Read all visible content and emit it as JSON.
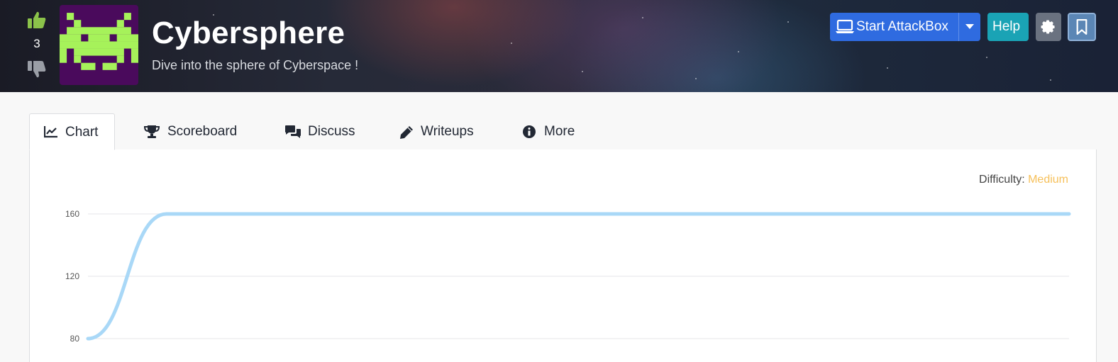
{
  "room": {
    "title": "Cybersphere",
    "subtitle": "Dive into the sphere of Cyberspace !",
    "votes": "3",
    "logo_colors": {
      "background": "#4a0a5c",
      "invader": "#a6f25a"
    }
  },
  "header_buttons": {
    "attackbox_label": "Start AttackBox",
    "help_label": "Help",
    "icons": [
      "thumbs-up-icon",
      "thumbs-down-icon",
      "laptop-icon",
      "caret-down-icon",
      "gear-icon",
      "bookmark-icon"
    ]
  },
  "tabs": [
    {
      "label": "Chart",
      "icon": "chart-line-icon",
      "active": true
    },
    {
      "label": "Scoreboard",
      "icon": "trophy-icon"
    },
    {
      "label": "Discuss",
      "icon": "comments-icon"
    },
    {
      "label": "Writeups",
      "icon": "pen-icon"
    },
    {
      "label": "More",
      "icon": "info-circle-icon"
    }
  ],
  "difficulty": {
    "label": "Difficulty: ",
    "value": "Medium",
    "color": "#f6c05a"
  },
  "colors": {
    "primary": "#2f6be0",
    "help": "#1aa3b5",
    "settings": "#6a7280",
    "bookmark": "#5b86b5",
    "upvote": "#8bc34a",
    "line": "#a9d8f7"
  },
  "chart_data": {
    "type": "line",
    "y_ticks": [
      80,
      120,
      160
    ],
    "ylim_visible": [
      80,
      160
    ],
    "series": [
      {
        "points": [
          [
            0,
            80
          ],
          [
            0.08,
            160
          ],
          [
            1,
            160
          ]
        ]
      }
    ]
  }
}
